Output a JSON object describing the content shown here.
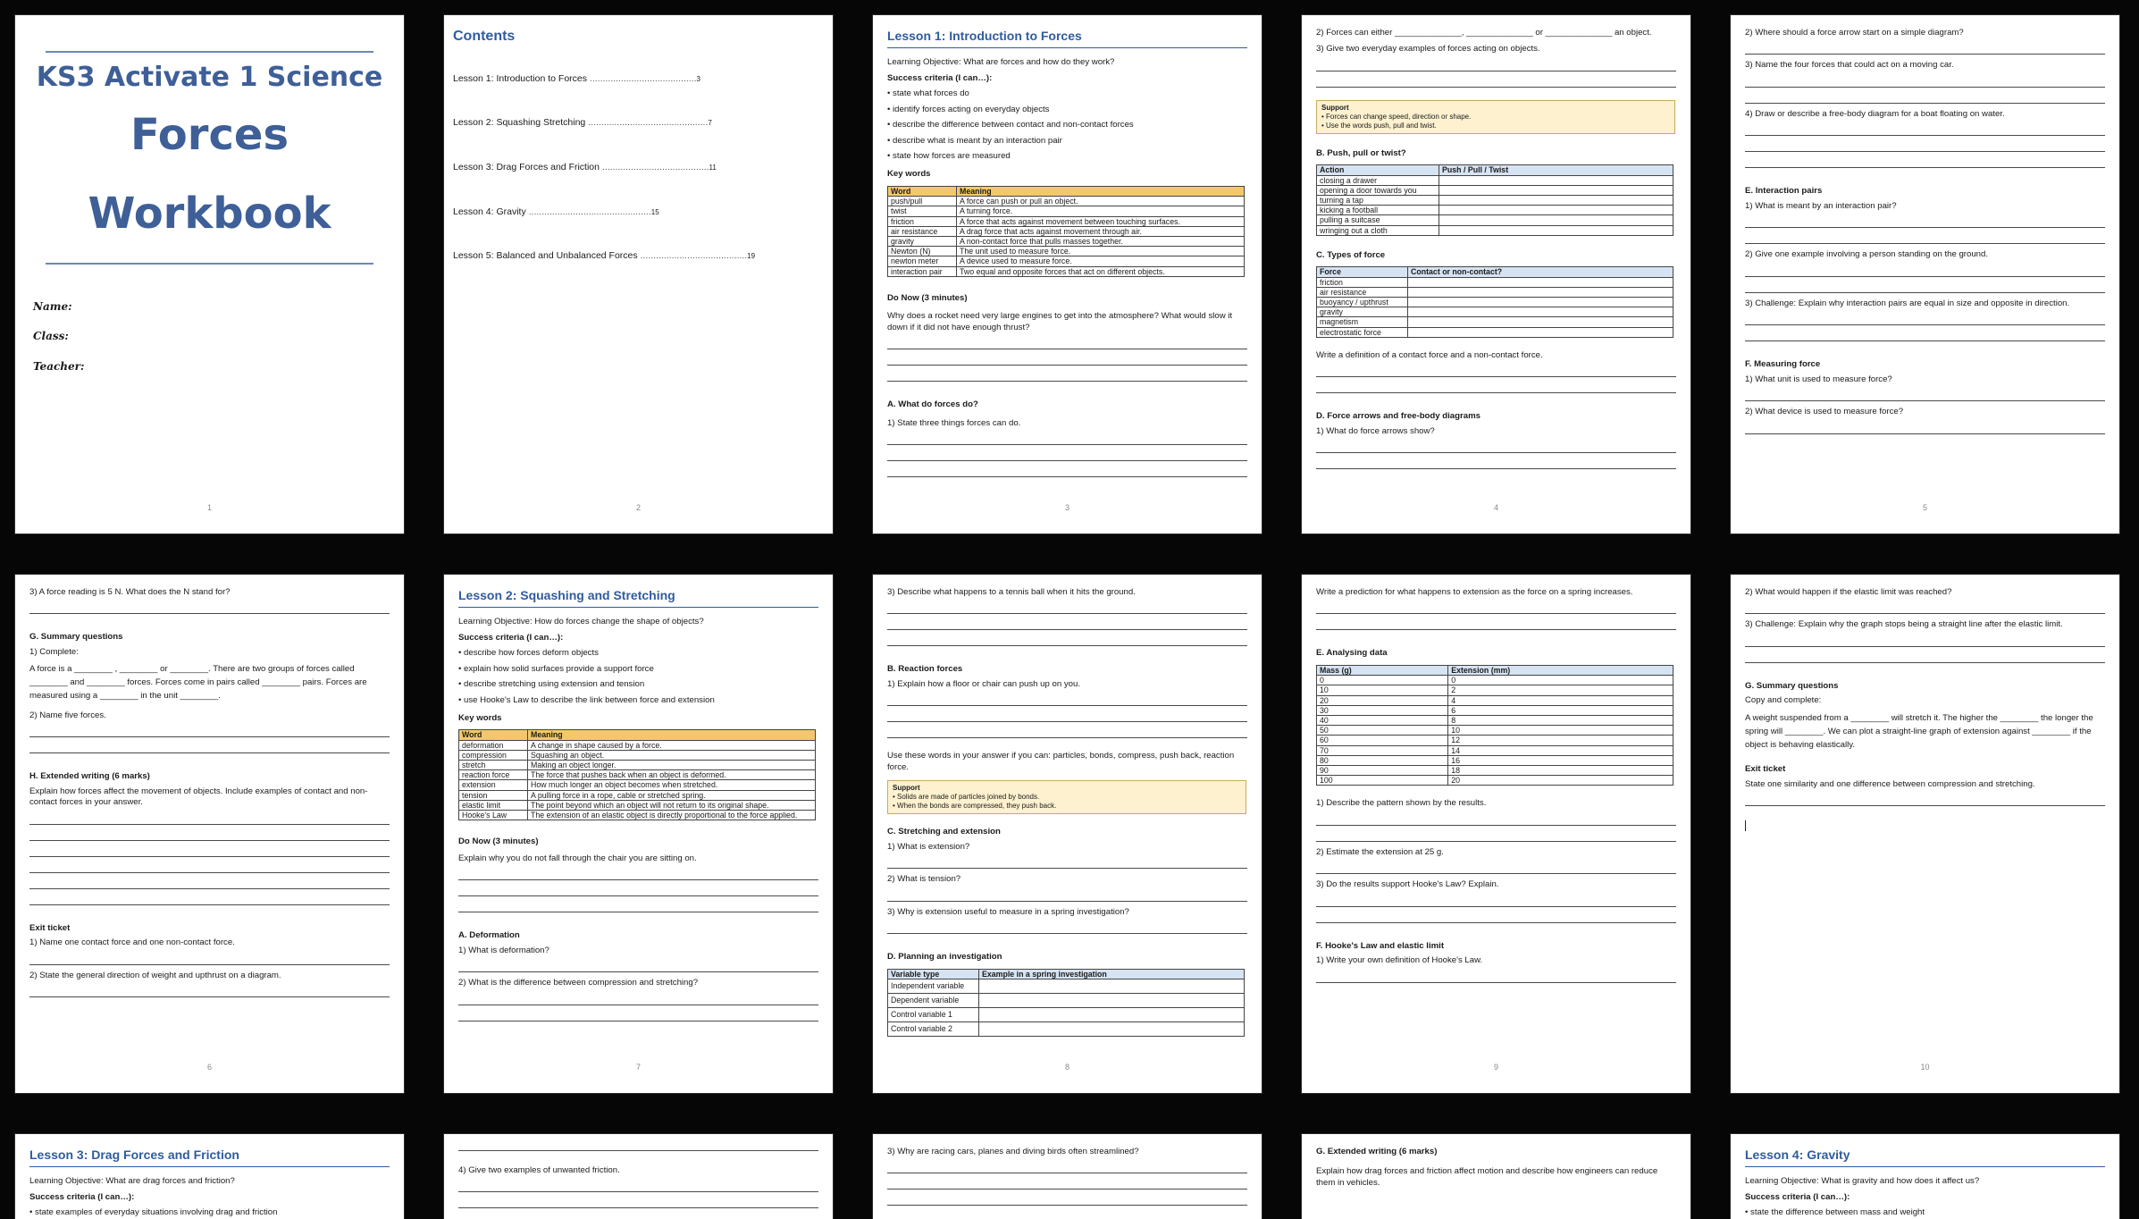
{
  "cover": {
    "line1": "KS3 Activate 1 Science",
    "line2": "Forces",
    "line3": "Workbook",
    "fields": [
      "Name:",
      "Class:",
      "Teacher:"
    ],
    "page": "1"
  },
  "contents": {
    "title": "Contents",
    "items": [
      {
        "label": "Lesson 1: Introduction to Forces",
        "dots": ".........................................",
        "page": "3"
      },
      {
        "label": "Lesson 2: Squashing Stretching",
        "dots": "..............................................",
        "page": "7"
      },
      {
        "label": "Lesson 3: Drag Forces and Friction",
        "dots": ".........................................",
        "page": "11"
      },
      {
        "label": "Lesson 4: Gravity",
        "dots": "...............................................",
        "page": "15"
      },
      {
        "label": "Lesson 5: Balanced and Unbalanced Forces",
        "dots": ".........................................",
        "page": "19"
      }
    ],
    "page": "2"
  },
  "p3": {
    "title": "Lesson 1: Introduction to Forces",
    "objective": "Learning Objective: What are forces and how do they work?",
    "criteria_head": "Success criteria (I can…):",
    "criteria": [
      "state what forces do",
      "identify forces acting on everyday objects",
      "describe the difference between contact and non-contact forces",
      "describe what is meant by an interaction pair",
      "state how forces are measured"
    ],
    "keywords_head": "Key words",
    "table_head": [
      "Word",
      "Meaning"
    ],
    "rows": [
      [
        "push/pull",
        "A force can push or pull an object."
      ],
      [
        "twist",
        "A turning force."
      ],
      [
        "friction",
        "A force that acts against movement between touching surfaces."
      ],
      [
        "air resistance",
        "A drag force that acts against movement through air."
      ],
      [
        "gravity",
        "A non-contact force that pulls masses together."
      ],
      [
        "Newton (N)",
        "The unit used to measure force."
      ],
      [
        "newton meter",
        "A device used to measure force."
      ],
      [
        "interaction pair",
        "Two equal and opposite forces that act on different objects."
      ]
    ],
    "donow_head": "Do Now (3 minutes)",
    "donow": "Why does a rocket need very large engines to get into the atmosphere? What would slow it down if it did not have enough thrust?",
    "secA": "A. What do forces do?",
    "q1": "1) State three things forces can do.",
    "page": "3"
  },
  "p4": {
    "q2_a": "2) Forces can either",
    "q2_b": "or",
    "q2_c": "an object.",
    "q3": "3) Give two everyday examples of forces acting on objects.",
    "support_head": "Support",
    "support_lines": [
      "• Forces can change speed, direction or shape.",
      "• Use the words push, pull and twist."
    ],
    "secB": "B. Push, pull or twist?",
    "tableB_head": [
      "Action",
      "Push / Pull / Twist"
    ],
    "tableB_rows": [
      "closing a drawer",
      "opening a door towards you",
      "turning a tap",
      "kicking a football",
      "pulling a suitcase",
      "wringing out a cloth"
    ],
    "secC": "C. Types of force",
    "tableC_head": [
      "Force",
      "Contact or non-contact?"
    ],
    "tableC_rows": [
      "friction",
      "air resistance",
      "buoyancy / upthrust",
      "gravity",
      "magnetism",
      "electrostatic force"
    ],
    "def": "Write a definition of a contact force and a non-contact force.",
    "secD": "D. Force arrows and free-body diagrams",
    "qD1": "1) What do force arrows show?",
    "page": "4"
  },
  "p5": {
    "q2": "2) Where should a force arrow start on a simple diagram?",
    "q3": "3) Name the four forces that could act on a moving car.",
    "q4": "4) Draw or describe a free-body diagram for a boat floating on water.",
    "secE": "E. Interaction pairs",
    "qE1": "1) What is meant by an interaction pair?",
    "qE2": "2) Give one example involving a person standing on the ground.",
    "qE3": "3) Challenge: Explain why interaction pairs are equal in size and opposite in direction.",
    "secF": "F. Measuring force",
    "qF1": "1) What unit is used to measure force?",
    "qF2": "2) What device is used to measure force?",
    "page": "5"
  },
  "p6": {
    "q3": "3) A force reading is 5 N. What does the N stand for?",
    "secG": "G. Summary questions",
    "g1": "1) Complete:",
    "g1_text": "A force is a ________ , ________ or ________. There are two groups of forces called ________ and ________ forces. Forces come in pairs called ________ pairs. Forces are measured using a ________ in the unit ________.",
    "g2": "2) Name five forces.",
    "secH": "H. Extended writing (6 marks)",
    "h_text": "Explain how forces affect the movement of objects. Include examples of contact and non-contact forces in your answer.",
    "exit": "Exit ticket",
    "e1": "1) Name one contact force and one non-contact force.",
    "e2": "2) State the general direction of weight and upthrust on a diagram.",
    "page": "6"
  },
  "p7": {
    "title": "Lesson 2: Squashing and Stretching",
    "objective": "Learning Objective: How do forces change the shape of objects?",
    "criteria_head": "Success criteria (I can…):",
    "criteria": [
      "describe how forces deform objects",
      "explain how solid surfaces provide a support force",
      "describe stretching using extension and tension",
      "use Hooke's Law to describe the link between force and extension"
    ],
    "keywords_head": "Key words",
    "table_head": [
      "Word",
      "Meaning"
    ],
    "rows": [
      [
        "deformation",
        "A change in shape caused by a force."
      ],
      [
        "compression",
        "Squashing an object."
      ],
      [
        "stretch",
        "Making an object longer."
      ],
      [
        "reaction force",
        "The force that pushes back when an object is deformed."
      ],
      [
        "extension",
        "How much longer an object becomes when stretched."
      ],
      [
        "tension",
        "A pulling force in a rope, cable or stretched spring."
      ],
      [
        "elastic limit",
        "The point beyond which an object will not return to its original shape."
      ],
      [
        "Hooke's Law",
        "The extension of an elastic object is directly proportional to the force applied."
      ]
    ],
    "donow_head": "Do Now (3 minutes)",
    "donow": "Explain why you do not fall through the chair you are sitting on.",
    "secA": "A. Deformation",
    "a1": "1) What is deformation?",
    "a2": "2) What is the difference between compression and stretching?",
    "page": "7"
  },
  "p8": {
    "q3": "3) Describe what happens to a tennis ball when it hits the ground.",
    "secB": "B. Reaction forces",
    "b1": "1) Explain how a floor or chair can push up on you.",
    "words": "Use these words in your answer if you can: particles, bonds, compress, push back, reaction force.",
    "support_head": "Support",
    "support_lines": [
      "• Solids are made of particles joined by bonds.",
      "• When the bonds are compressed, they push back."
    ],
    "secC": "C. Stretching and extension",
    "c1": "1) What is extension?",
    "c2": "2) What is tension?",
    "c3": "3) Why is extension useful to measure in a spring investigation?",
    "secD": "D. Planning an investigation",
    "tableD_head": [
      "Variable type",
      "Example in a spring investigation"
    ],
    "tableD_rows": [
      "Independent variable",
      "Dependent variable",
      "Control variable 1",
      "Control variable 2"
    ],
    "page": "8"
  },
  "p9": {
    "pred": "Write a prediction for what happens to extension as the force on a spring increases.",
    "secE": "E. Analysing data",
    "table_head": [
      "Mass (g)",
      "Extension (mm)"
    ],
    "rows": [
      [
        "0",
        "0"
      ],
      [
        "10",
        "2"
      ],
      [
        "20",
        "4"
      ],
      [
        "30",
        "6"
      ],
      [
        "40",
        "8"
      ],
      [
        "50",
        "10"
      ],
      [
        "60",
        "12"
      ],
      [
        "70",
        "14"
      ],
      [
        "80",
        "16"
      ],
      [
        "90",
        "18"
      ],
      [
        "100",
        "20"
      ]
    ],
    "e1": "1) Describe the pattern shown by the results.",
    "e2": "2) Estimate the extension at 25 g.",
    "e3": "3) Do the results support Hooke's Law? Explain.",
    "secF": "F. Hooke's Law and elastic limit",
    "f1": "1) Write your own definition of Hooke's Law.",
    "page": "9"
  },
  "p10": {
    "q2": "2) What would happen if the elastic limit was reached?",
    "q3": "3) Challenge: Explain why the graph stops being a straight line after the elastic limit.",
    "secG": "G. Summary questions",
    "copy": "Copy and complete:",
    "g_text": "A weight suspended from a ________ will stretch it. The higher the ________ the longer the spring will ________. We can plot a straight-line graph of extension against ________ if the object is behaving elastically.",
    "exit": "Exit ticket",
    "exit_q": "State one similarity and one difference between compression and stretching.",
    "page": "10"
  },
  "p11": {
    "title": "Lesson 3: Drag Forces and Friction",
    "objective": "Learning Objective: What are drag forces and friction?",
    "criteria_head": "Success criteria (I can…):",
    "c1": "state examples of everyday situations involving drag and friction"
  },
  "p12": {
    "q4": "4) Give two examples of unwanted friction."
  },
  "p13": {
    "q3": "3) Why are racing cars, planes and diving birds often streamlined?"
  },
  "p14": {
    "secG": "G. Extended writing (6 marks)",
    "text": "Explain how drag forces and friction affect motion and describe how engineers can reduce them in vehicles."
  },
  "p15": {
    "title": "Lesson 4: Gravity",
    "objective": "Learning Objective: What is gravity and how does it affect us?",
    "criteria_head": "Success criteria (I can…):",
    "c1": "state the difference between mass and weight"
  }
}
